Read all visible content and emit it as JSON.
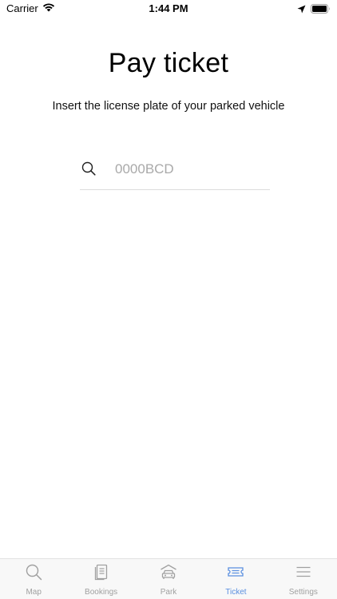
{
  "status_bar": {
    "carrier": "Carrier",
    "time": "1:44 PM"
  },
  "header": {
    "title": "Pay ticket",
    "subtitle": "Insert the license plate of your parked vehicle"
  },
  "plate_search": {
    "placeholder": "0000BCD",
    "value": ""
  },
  "tab_bar": {
    "active_tab": "Ticket",
    "accent_color": "#5a8fe0",
    "inactive_color": "#a0a0a0",
    "tabs": [
      {
        "label": "Map",
        "icon": "search-icon"
      },
      {
        "label": "Bookings",
        "icon": "document-icon"
      },
      {
        "label": "Park",
        "icon": "car-garage-icon"
      },
      {
        "label": "Ticket",
        "icon": "ticket-icon"
      },
      {
        "label": "Settings",
        "icon": "menu-icon"
      }
    ]
  }
}
